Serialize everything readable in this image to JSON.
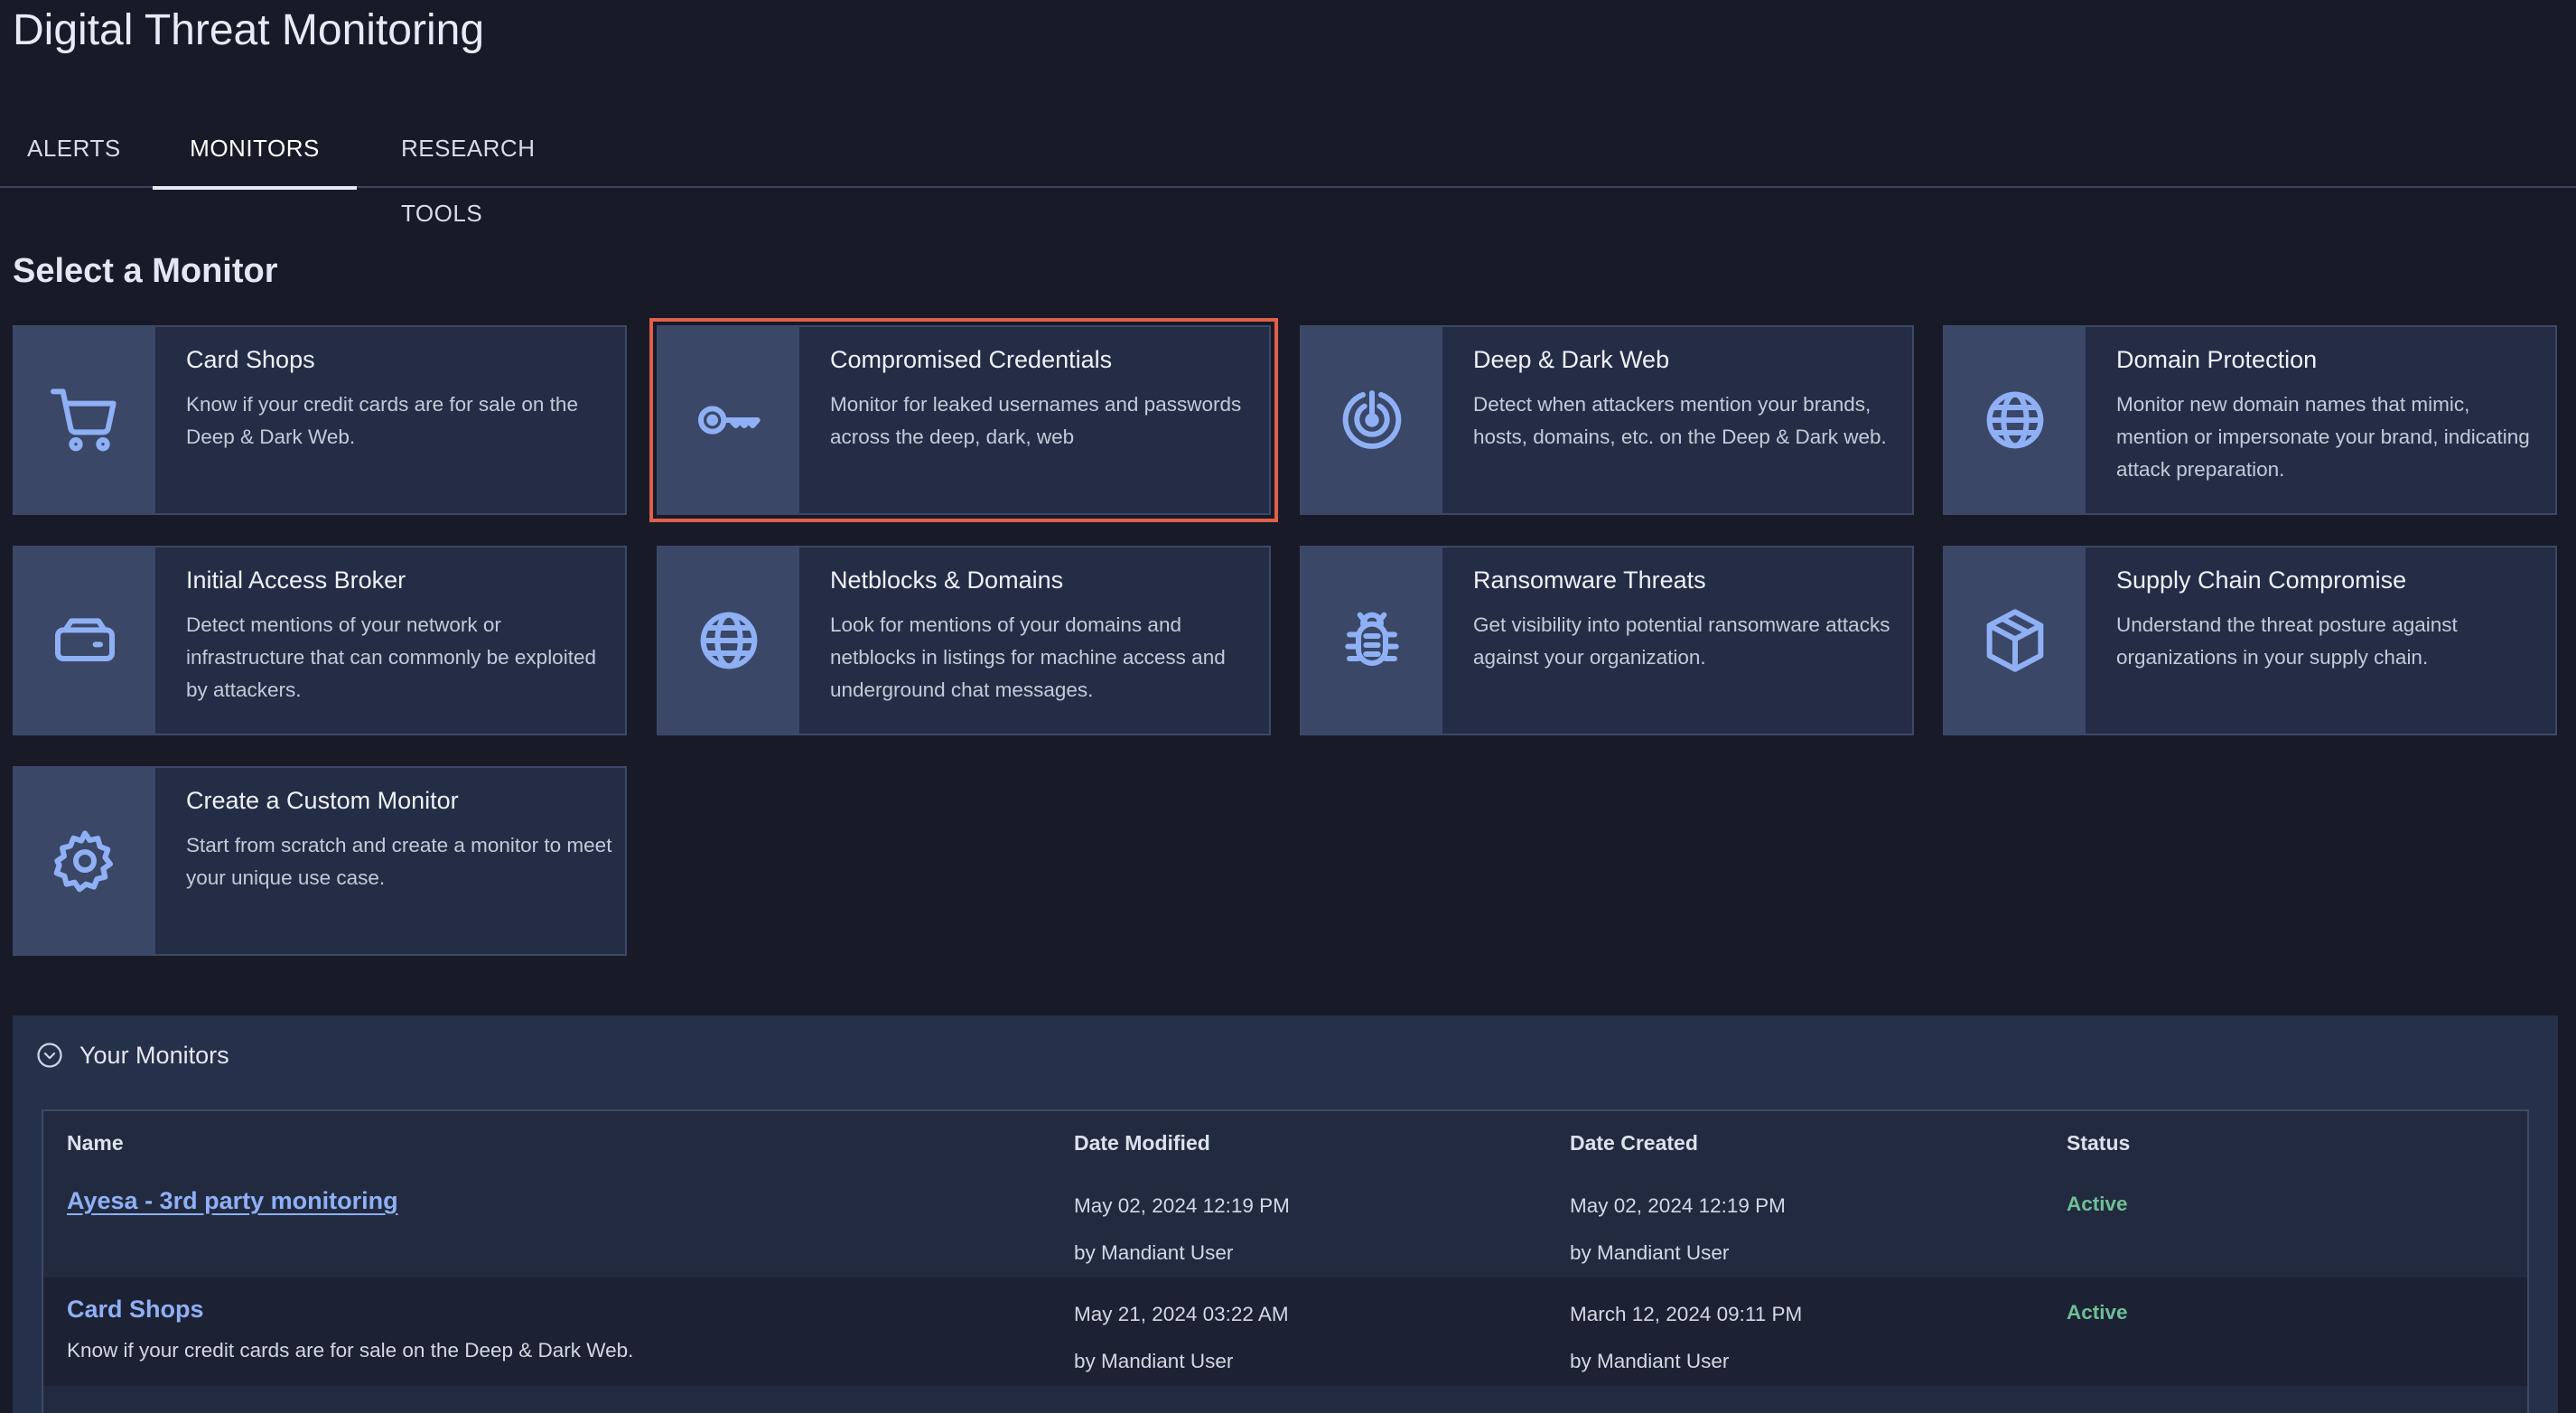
{
  "page": {
    "title": "Digital Threat Monitoring"
  },
  "tabs": [
    {
      "label": "ALERTS"
    },
    {
      "label": "MONITORS",
      "active": true
    },
    {
      "label": "RESEARCH TOOLS"
    }
  ],
  "select_monitor": {
    "title": "Select a Monitor",
    "cards": [
      {
        "title": "Card Shops",
        "description": "Know if your credit cards are for sale on the Deep & Dark Web.",
        "icon": "shopping-cart-icon"
      },
      {
        "title": "Compromised Credentials",
        "description": "Monitor for leaked usernames and passwords across the deep, dark, web",
        "icon": "key-icon",
        "selected": true
      },
      {
        "title": "Deep & Dark Web",
        "description": "Detect when attackers mention your brands, hosts, domains, etc. on the Deep & Dark web.",
        "icon": "radar-icon"
      },
      {
        "title": "Domain Protection",
        "description": "Monitor new domain names that mimic, mention or impersonate your brand, indicating attack preparation.",
        "icon": "globe-icon"
      },
      {
        "title": "Initial Access Broker",
        "description": "Detect mentions of your network or infrastructure that can commonly be exploited by attackers.",
        "icon": "hard-drive-icon"
      },
      {
        "title": "Netblocks & Domains",
        "description": "Look for mentions of your domains and netblocks in listings for machine access and underground chat messages.",
        "icon": "globe-icon"
      },
      {
        "title": "Ransomware Threats",
        "description": "Get visibility into potential ransomware attacks against your organization.",
        "icon": "bug-icon"
      },
      {
        "title": "Supply Chain Compromise",
        "description": "Understand the threat posture against organizations in your supply chain.",
        "icon": "package-icon"
      },
      {
        "title": "Create a Custom Monitor",
        "description": "Start from scratch and create a monitor to meet your unique use case.",
        "icon": "gear-icon"
      }
    ]
  },
  "your_monitors": {
    "title": "Your Monitors",
    "toggle_icon": "chevron-circle-down-icon",
    "columns": {
      "name": "Name",
      "date_modified": "Date Modified",
      "date_created": "Date Created",
      "status": "Status"
    },
    "rows": [
      {
        "name": "Ayesa - 3rd party monitoring",
        "description": "",
        "modified_date": "May 02, 2024 12:19 PM",
        "modified_by": "by Mandiant User",
        "created_date": "May 02, 2024 12:19 PM",
        "created_by": "by Mandiant User",
        "status": "Active"
      },
      {
        "name": "Card Shops",
        "description": "Know if your credit cards are for sale on the Deep & Dark Web.",
        "modified_date": "May 21, 2024 03:22 AM",
        "modified_by": "by Mandiant User",
        "created_date": "March 12, 2024 09:11 PM",
        "created_by": "by Mandiant User",
        "status": "Active"
      }
    ]
  },
  "colors": {
    "background": "#181a27",
    "card": "#252d46",
    "icon_panel": "#3a4766",
    "icon": "#8fb0f5",
    "link": "#8fb0f5",
    "status_active": "#6fbf95",
    "selection_outline": "#e0604b"
  }
}
